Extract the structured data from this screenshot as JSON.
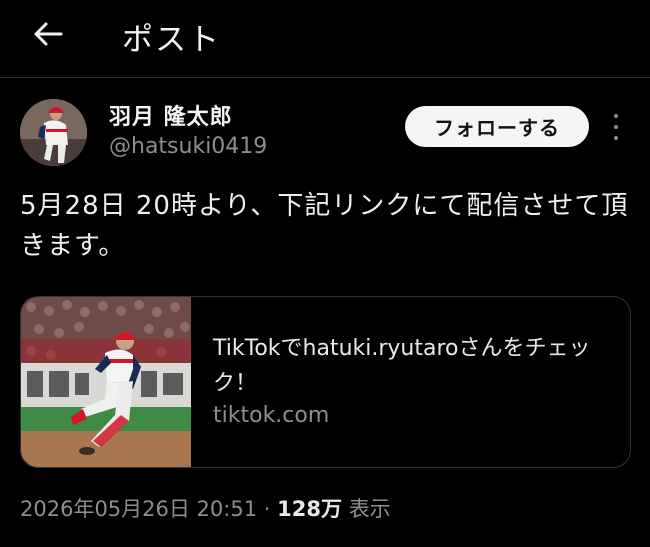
{
  "header": {
    "title": "ポスト",
    "back_icon": "arrow-left-icon"
  },
  "author": {
    "display_name": "羽月 隆太郎",
    "handle": "@hatsuki0419",
    "follow_label": "フォローする"
  },
  "tweet": {
    "text": "5月28日 20時より、下記リンクにて配信させて頂きます。"
  },
  "link_card": {
    "title": "TikTokでhatuki.ryutaroさんをチェック！",
    "domain": "tiktok.com"
  },
  "meta": {
    "timestamp": "2026年05月26日 20:51",
    "separator": "·",
    "views_count": "128万",
    "views_label": "表示"
  },
  "colors": {
    "background": "#000000",
    "text_primary": "#e7e9ea",
    "text_secondary": "#8b8f93",
    "divider": "#2f3336",
    "follow_button_bg": "#f5f5f5"
  }
}
